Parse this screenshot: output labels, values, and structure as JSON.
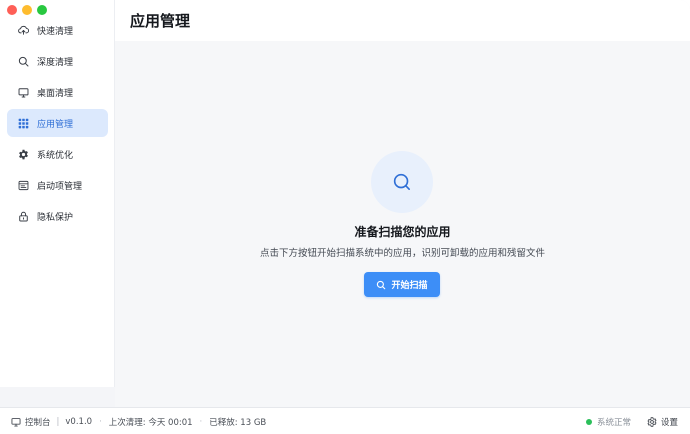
{
  "window": {
    "controls": [
      {
        "name": "close",
        "color": "#fe5f57"
      },
      {
        "name": "minimize",
        "color": "#febc2e"
      },
      {
        "name": "maximize",
        "color": "#28c840"
      }
    ]
  },
  "sidebar": {
    "items": [
      {
        "label": "快速清理",
        "icon": "cloud-upload-icon",
        "active": false
      },
      {
        "label": "深度清理",
        "icon": "search-icon",
        "active": false
      },
      {
        "label": "桌面清理",
        "icon": "monitor-icon",
        "active": false
      },
      {
        "label": "应用管理",
        "icon": "grid-icon",
        "active": true
      },
      {
        "label": "系统优化",
        "icon": "gear-icon",
        "active": false
      },
      {
        "label": "启动项管理",
        "icon": "startup-icon",
        "active": false
      },
      {
        "label": "隐私保护",
        "icon": "lock-icon",
        "active": false
      }
    ]
  },
  "header": {
    "title": "应用管理"
  },
  "empty_state": {
    "icon": "search-icon",
    "title": "准备扫描您的应用",
    "description": "点击下方按钮开始扫描系统中的应用，识别可卸载的应用和残留文件",
    "button_label": "开始扫描",
    "button_icon": "search-icon"
  },
  "statusbar": {
    "console_label": "控制台",
    "console_icon": "monitor-icon",
    "version": "v0.1.0",
    "last_clean": "上次清理: 今天 00:01",
    "freed": "已释放: 13 GB",
    "status_text": "系统正常",
    "status_color": "#2bbf5a",
    "settings_label": "设置",
    "settings_icon": "gear-icon"
  },
  "colors": {
    "accent": "#3d8ef7",
    "active_bg": "#dce9fd",
    "active_text": "#2f6fd6"
  }
}
